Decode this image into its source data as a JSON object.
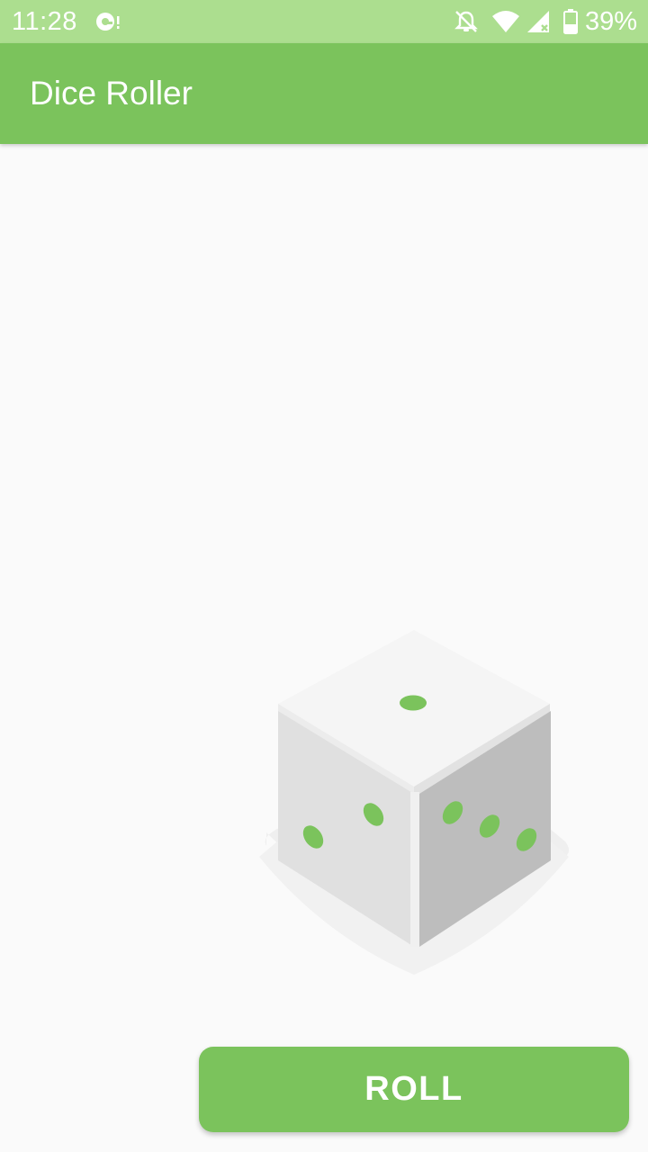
{
  "status_bar": {
    "time": "11:28",
    "battery_percent": "39%",
    "icons": [
      "notification-icon",
      "bell-off-icon",
      "wifi-icon",
      "cell-signal-icon",
      "battery-icon"
    ]
  },
  "app_bar": {
    "title": "Dice Roller"
  },
  "dice": {
    "top_face_pips": 1,
    "left_face_pips": 2,
    "right_face_pips": 3,
    "pip_color": "#7bc35c"
  },
  "roll_button": {
    "label": "ROLL"
  },
  "colors": {
    "accent": "#7bc35c",
    "status_bar": "#acde8f",
    "background": "#fafafa",
    "dice_top": "#f5f5f5",
    "dice_left": "#e0e0e0",
    "dice_right": "#bdbdbd"
  }
}
